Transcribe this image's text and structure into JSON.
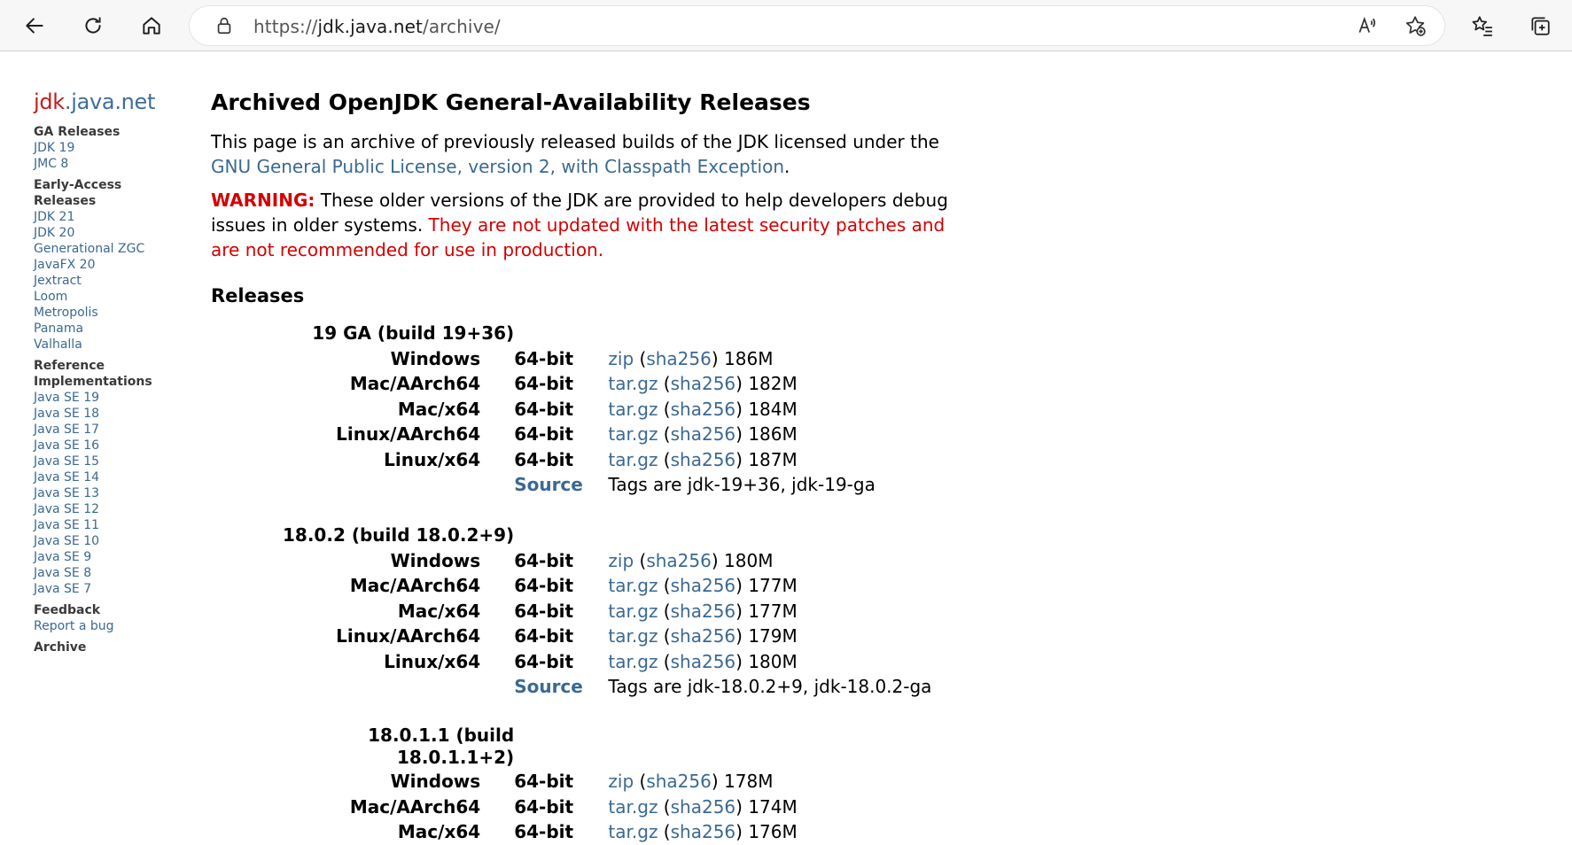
{
  "browser": {
    "url_prefix": "https://",
    "url_host": "jdk.java.net",
    "url_path": "/archive/"
  },
  "sidebar": {
    "logo_red": "jdk",
    "logo_blue": ".java.net",
    "groups": [
      {
        "heading": "GA Releases",
        "links": [
          "JDK 19",
          "JMC 8"
        ]
      },
      {
        "heading": "Early-Access Releases",
        "links": [
          "JDK 21",
          "JDK 20",
          "Generational ZGC",
          "JavaFX 20",
          "Jextract",
          "Loom",
          "Metropolis",
          "Panama",
          "Valhalla"
        ]
      },
      {
        "heading": "Reference Implementations",
        "links": [
          "Java SE 19",
          "Java SE 18",
          "Java SE 17",
          "Java SE 16",
          "Java SE 15",
          "Java SE 14",
          "Java SE 13",
          "Java SE 12",
          "Java SE 11",
          "Java SE 10",
          "Java SE 9",
          "Java SE 8",
          "Java SE 7"
        ]
      },
      {
        "heading": "Feedback",
        "links": [
          "Report a bug"
        ]
      },
      {
        "heading": "Archive",
        "links": []
      }
    ]
  },
  "main": {
    "title": "Archived OpenJDK General-Availability Releases",
    "intro_text": "This page is an archive of previously released builds of the JDK licensed under the",
    "intro_link": "GNU General Public License, version 2, with Classpath Exception",
    "intro_end": ".",
    "warning_label": "WARNING:",
    "warning_text": " These older versions of the JDK are provided to help developers debug issues in older systems.",
    "warning_red": " They are not updated with the latest security patches and are not recommended for use in production.",
    "releases_heading": "Releases",
    "sha_label": "sha256",
    "releases": [
      {
        "name": "19 GA (build 19+36)",
        "rows": [
          {
            "platform": "Windows",
            "bits": "64-bit",
            "file": "zip",
            "size": "186M"
          },
          {
            "platform": "Mac/AArch64",
            "bits": "64-bit",
            "file": "tar.gz",
            "size": "182M"
          },
          {
            "platform": "Mac/x64",
            "bits": "64-bit",
            "file": "tar.gz",
            "size": "184M"
          },
          {
            "platform": "Linux/AArch64",
            "bits": "64-bit",
            "file": "tar.gz",
            "size": "186M"
          },
          {
            "platform": "Linux/x64",
            "bits": "64-bit",
            "file": "tar.gz",
            "size": "187M"
          }
        ],
        "source_label": "Source",
        "tags": "Tags are jdk-19+36, jdk-19-ga"
      },
      {
        "name": "18.0.2 (build 18.0.2+9)",
        "rows": [
          {
            "platform": "Windows",
            "bits": "64-bit",
            "file": "zip",
            "size": "180M"
          },
          {
            "platform": "Mac/AArch64",
            "bits": "64-bit",
            "file": "tar.gz",
            "size": "177M"
          },
          {
            "platform": "Mac/x64",
            "bits": "64-bit",
            "file": "tar.gz",
            "size": "177M"
          },
          {
            "platform": "Linux/AArch64",
            "bits": "64-bit",
            "file": "tar.gz",
            "size": "179M"
          },
          {
            "platform": "Linux/x64",
            "bits": "64-bit",
            "file": "tar.gz",
            "size": "180M"
          }
        ],
        "source_label": "Source",
        "tags": "Tags are jdk-18.0.2+9, jdk-18.0.2-ga"
      },
      {
        "name_line1": "18.0.1.1 (build",
        "name_line2": "18.0.1.1+2)",
        "rows": [
          {
            "platform": "Windows",
            "bits": "64-bit",
            "file": "zip",
            "size": "178M"
          },
          {
            "platform": "Mac/AArch64",
            "bits": "64-bit",
            "file": "tar.gz",
            "size": "174M"
          },
          {
            "platform": "Mac/x64",
            "bits": "64-bit",
            "file": "tar.gz",
            "size": "176M"
          }
        ]
      }
    ]
  }
}
